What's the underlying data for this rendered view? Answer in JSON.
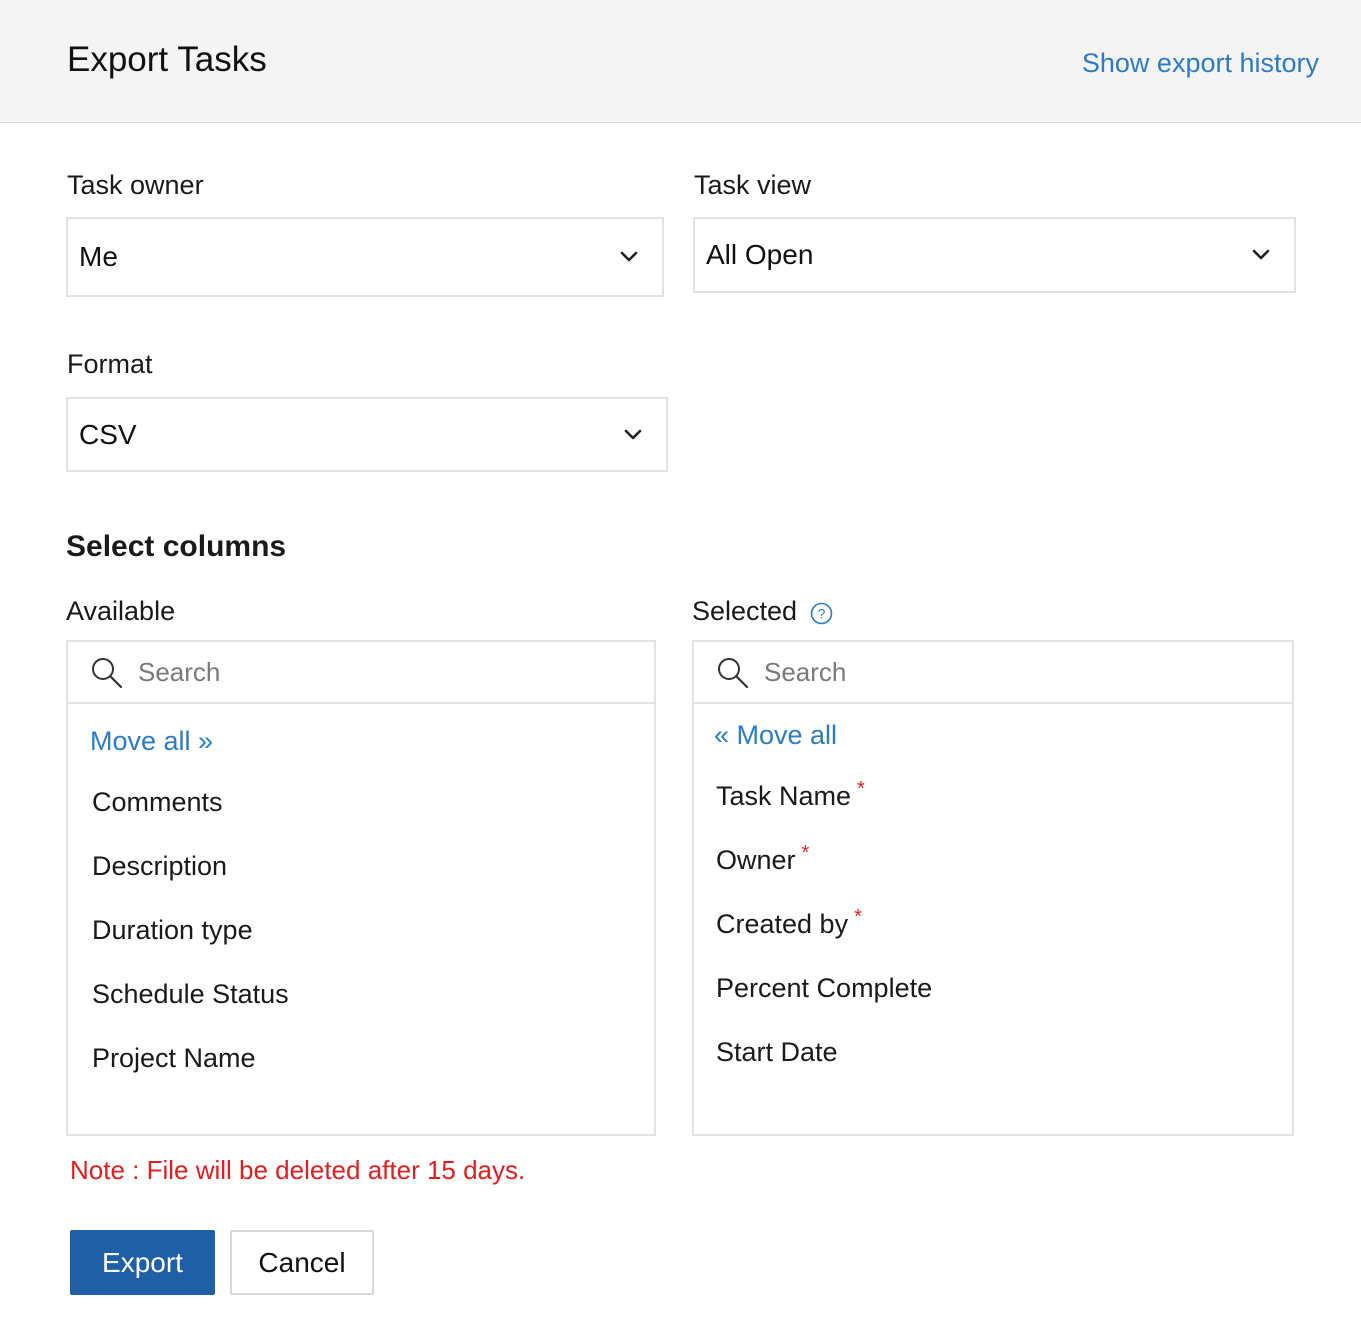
{
  "header": {
    "title": "Export Tasks",
    "history_link": "Show export history"
  },
  "fields": {
    "task_owner": {
      "label": "Task owner",
      "value": "Me"
    },
    "task_view": {
      "label": "Task view",
      "value": "All Open"
    },
    "format": {
      "label": "Format",
      "value": "CSV"
    }
  },
  "columns": {
    "title": "Select columns",
    "available": {
      "label": "Available",
      "search_placeholder": "Search",
      "move_all": "Move all »",
      "items": [
        "Comments",
        "Description",
        "Duration type",
        "Schedule Status",
        "Project Name"
      ]
    },
    "selected": {
      "label": "Selected",
      "search_placeholder": "Search",
      "move_all": "« Move all",
      "items": [
        {
          "label": "Task Name",
          "required": "*"
        },
        {
          "label": "Owner",
          "required": "*"
        },
        {
          "label": "Created by",
          "required": "*"
        },
        {
          "label": "Percent Complete",
          "required": ""
        },
        {
          "label": "Start Date",
          "required": ""
        }
      ]
    }
  },
  "note": "Note : File will be deleted after 15 days.",
  "actions": {
    "export_label": "Export",
    "cancel_label": "Cancel"
  },
  "icons": {
    "search": "search-icon",
    "chevron": "chevron-down-icon",
    "help": "help-icon"
  },
  "colors": {
    "link": "#2d7bc4",
    "primary": "#1f5fa6",
    "required": "#e02020",
    "header_bg": "#f4f4f4"
  }
}
